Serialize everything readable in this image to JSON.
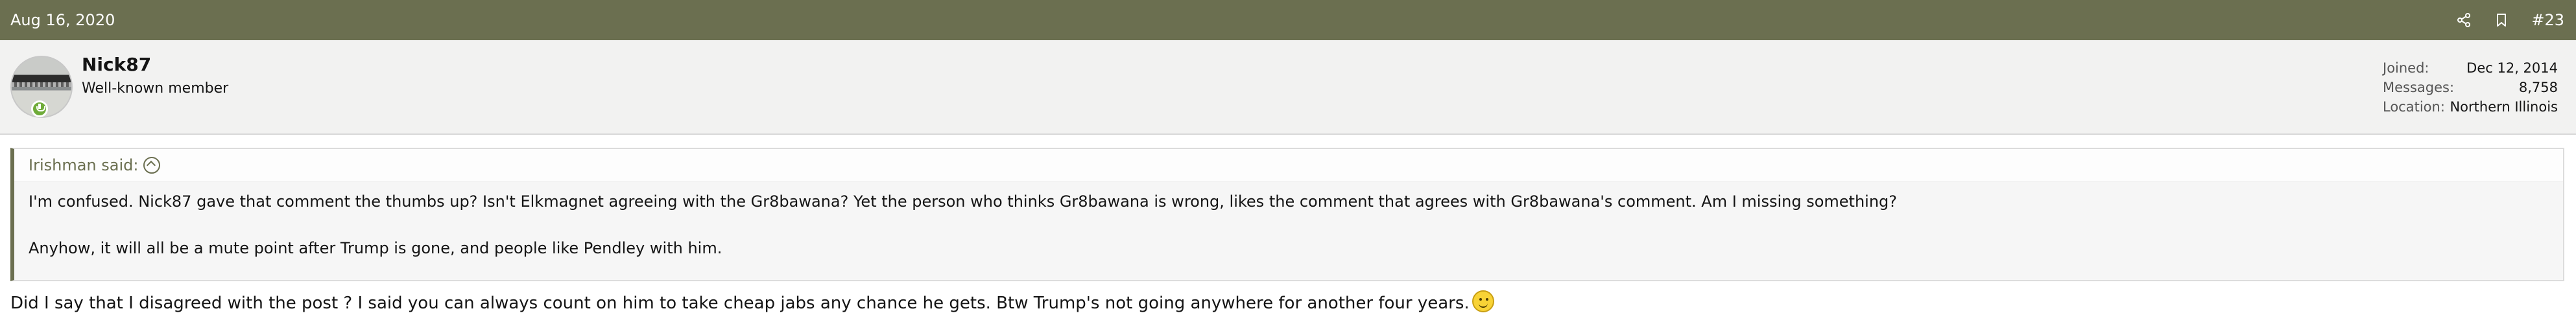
{
  "post": {
    "date": "Aug 16, 2020",
    "number": "#23",
    "actions": [
      {
        "name": "share",
        "icon": "share-icon"
      },
      {
        "name": "bookmark",
        "icon": "bookmark-icon"
      }
    ]
  },
  "user": {
    "name": "Nick87",
    "title": "Well-known member",
    "online_badge_icon": "online-status-icon",
    "stats": [
      {
        "label": "Joined:",
        "value": "Dec 12, 2014"
      },
      {
        "label": "Messages:",
        "value": "8,758"
      },
      {
        "label": "Location:",
        "value": "Northern Illinois"
      }
    ]
  },
  "quote": {
    "author": "Irishman said:",
    "arrow_icon": "quote-jump-icon",
    "paragraphs": [
      "I'm confused. Nick87 gave that comment the thumbs up? Isn't Elkmagnet agreeing with the Gr8bawana? Yet the person who thinks Gr8bawana is wrong, likes the comment that agrees with Gr8bawana's comment. Am I missing something?",
      "Anyhow, it will all be a mute point after Trump is gone, and people like Pendley with him."
    ]
  },
  "message": {
    "text": "Did I say that I disagreed with the post ? I said you can always count on him to take cheap jabs any chance he gets. Btw Trump's not going anywhere for another four years.",
    "emoji_icon": "smile-emoji-icon"
  },
  "colors": {
    "header_bar": "#6b6f50",
    "user_strip": "#f2f2f1",
    "quote_bg": "#f6f6f6",
    "quote_accent": "#6b6f50",
    "online_badge": "#6fab39"
  }
}
